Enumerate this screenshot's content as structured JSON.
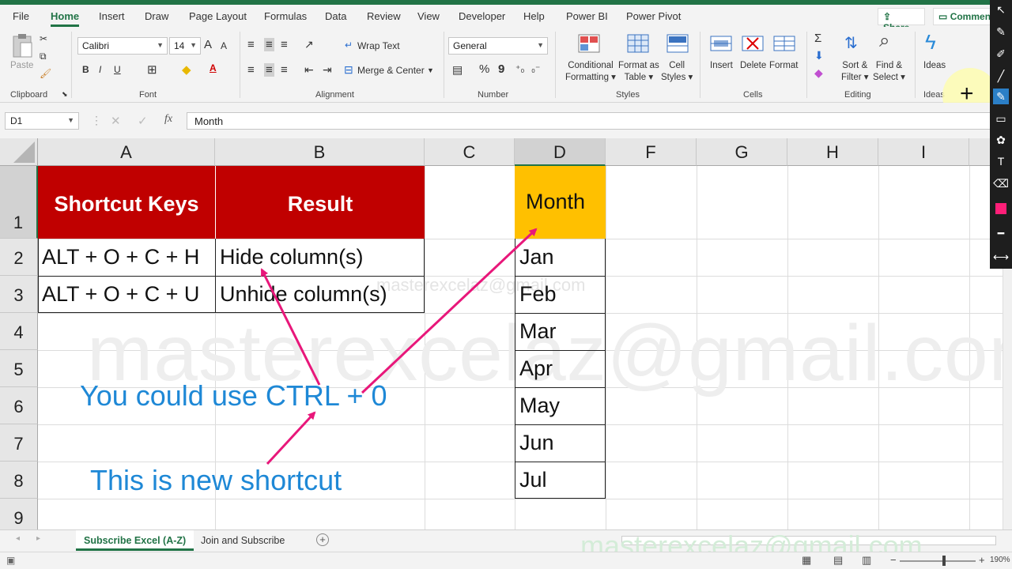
{
  "menu": {
    "tabs": [
      "File",
      "Home",
      "Insert",
      "Draw",
      "Page Layout",
      "Formulas",
      "Data",
      "Review",
      "View",
      "Developer",
      "Help",
      "Power BI",
      "Power Pivot"
    ],
    "active": "Home",
    "share": "Share",
    "comments": "Comments"
  },
  "ribbon": {
    "clipboard": {
      "paste": "Paste",
      "label": "Clipboard"
    },
    "font": {
      "name": "Calibri",
      "size": "14",
      "bold": "B",
      "italic": "I",
      "underline": "U",
      "grow": "A",
      "shrink": "A",
      "label": "Font"
    },
    "alignment": {
      "wrap": "Wrap Text",
      "merge": "Merge & Center",
      "label": "Alignment"
    },
    "number": {
      "format": "General",
      "percent": "%",
      "comma": "9",
      "label": "Number"
    },
    "styles": {
      "conditional": "Conditional",
      "conditional2": "Formatting",
      "formatas": "Format as",
      "formatas2": "Table",
      "cell": "Cell",
      "cell2": "Styles",
      "label": "Styles"
    },
    "cells": {
      "insert": "Insert",
      "delete": "Delete",
      "format": "Format",
      "label": "Cells"
    },
    "editing": {
      "sortfilter": "Sort &",
      "sortfilter2": "Filter",
      "findselect": "Find &",
      "findselect2": "Select",
      "sigma": "Σ",
      "label": "Editing"
    },
    "ideas": {
      "ideas": "Ideas",
      "label": "Ideas"
    }
  },
  "formula_bar": {
    "name_box": "D1",
    "fx": "fx",
    "value": "Month"
  },
  "grid": {
    "columns": [
      "A",
      "B",
      "C",
      "D",
      "F",
      "G",
      "H",
      "I"
    ],
    "rows": [
      "1",
      "2",
      "3",
      "4",
      "5",
      "6",
      "7",
      "8",
      "9"
    ],
    "header_shortcut": "Shortcut Keys",
    "header_result": "Result",
    "shortcuts": [
      {
        "keys": "ALT + O + C + H",
        "result": "Hide column(s)"
      },
      {
        "keys": "ALT + O + C + U",
        "result": "Unhide column(s)"
      }
    ],
    "month_header": "Month",
    "months": [
      "Jan",
      "Feb",
      "Mar",
      "Apr",
      "May",
      "Jun",
      "Jul"
    ]
  },
  "annotations": {
    "ctrl0": "You could use CTRL + 0",
    "new_shortcut": "This is new shortcut"
  },
  "watermark": "masterexcelaz@gmail.com",
  "sheets": {
    "active": "Subscribe Excel (A-Z)",
    "other": "Join and Subscribe"
  },
  "status": {
    "zoom": "190%"
  },
  "colors": {
    "excel_green": "#217346",
    "header_red": "#c00000",
    "month_orange": "#ffc000",
    "annotation_blue": "#1e88d6",
    "arrow_pink": "#e8177a"
  }
}
